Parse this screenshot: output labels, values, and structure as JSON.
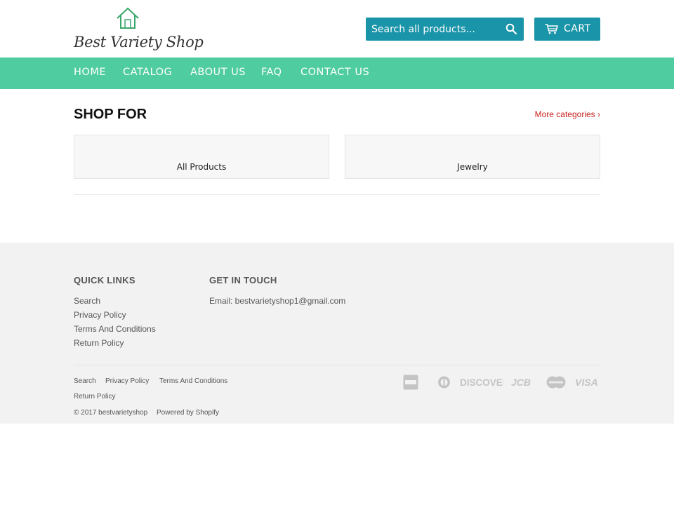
{
  "header": {
    "logo_text": "Best Variety Shop",
    "search_placeholder": "Search all products...",
    "cart_label": "CART",
    "accent_color": "#1a94a8"
  },
  "nav": {
    "background": "#4fcca0",
    "items": [
      {
        "label": "HOME"
      },
      {
        "label": "CATALOG"
      },
      {
        "label": "ABOUT US"
      },
      {
        "label": "FAQ"
      },
      {
        "label": "CONTACT US"
      }
    ]
  },
  "main": {
    "title": "SHOP FOR",
    "more_link": "More categories ›",
    "collections": [
      {
        "label": "All Products"
      },
      {
        "label": "Jewelry"
      }
    ]
  },
  "footer": {
    "quick_links_heading": "QUICK LINKS",
    "quick_links": [
      {
        "label": "Search"
      },
      {
        "label": "Privacy Policy"
      },
      {
        "label": "Terms And Conditions"
      },
      {
        "label": "Return Policy"
      }
    ],
    "contact_heading": "GET IN TOUCH",
    "email": "Email: bestvarietyshop1@gmail.com",
    "bottom_links": [
      {
        "label": "Search"
      },
      {
        "label": "Privacy Policy"
      },
      {
        "label": "Terms And Conditions"
      },
      {
        "label": "Return Policy"
      }
    ],
    "copyright": "© 2017 bestvarietyshop",
    "powered_by": "Powered by Shopify",
    "payment_icons": [
      "american-express-icon",
      "diners-club-icon",
      "discover-icon",
      "jcb-icon",
      "mastercard-icon",
      "visa-icon"
    ],
    "payment_labels": {
      "discover": "DISCOVER",
      "jcb": "JCB",
      "visa": "VISA"
    }
  }
}
